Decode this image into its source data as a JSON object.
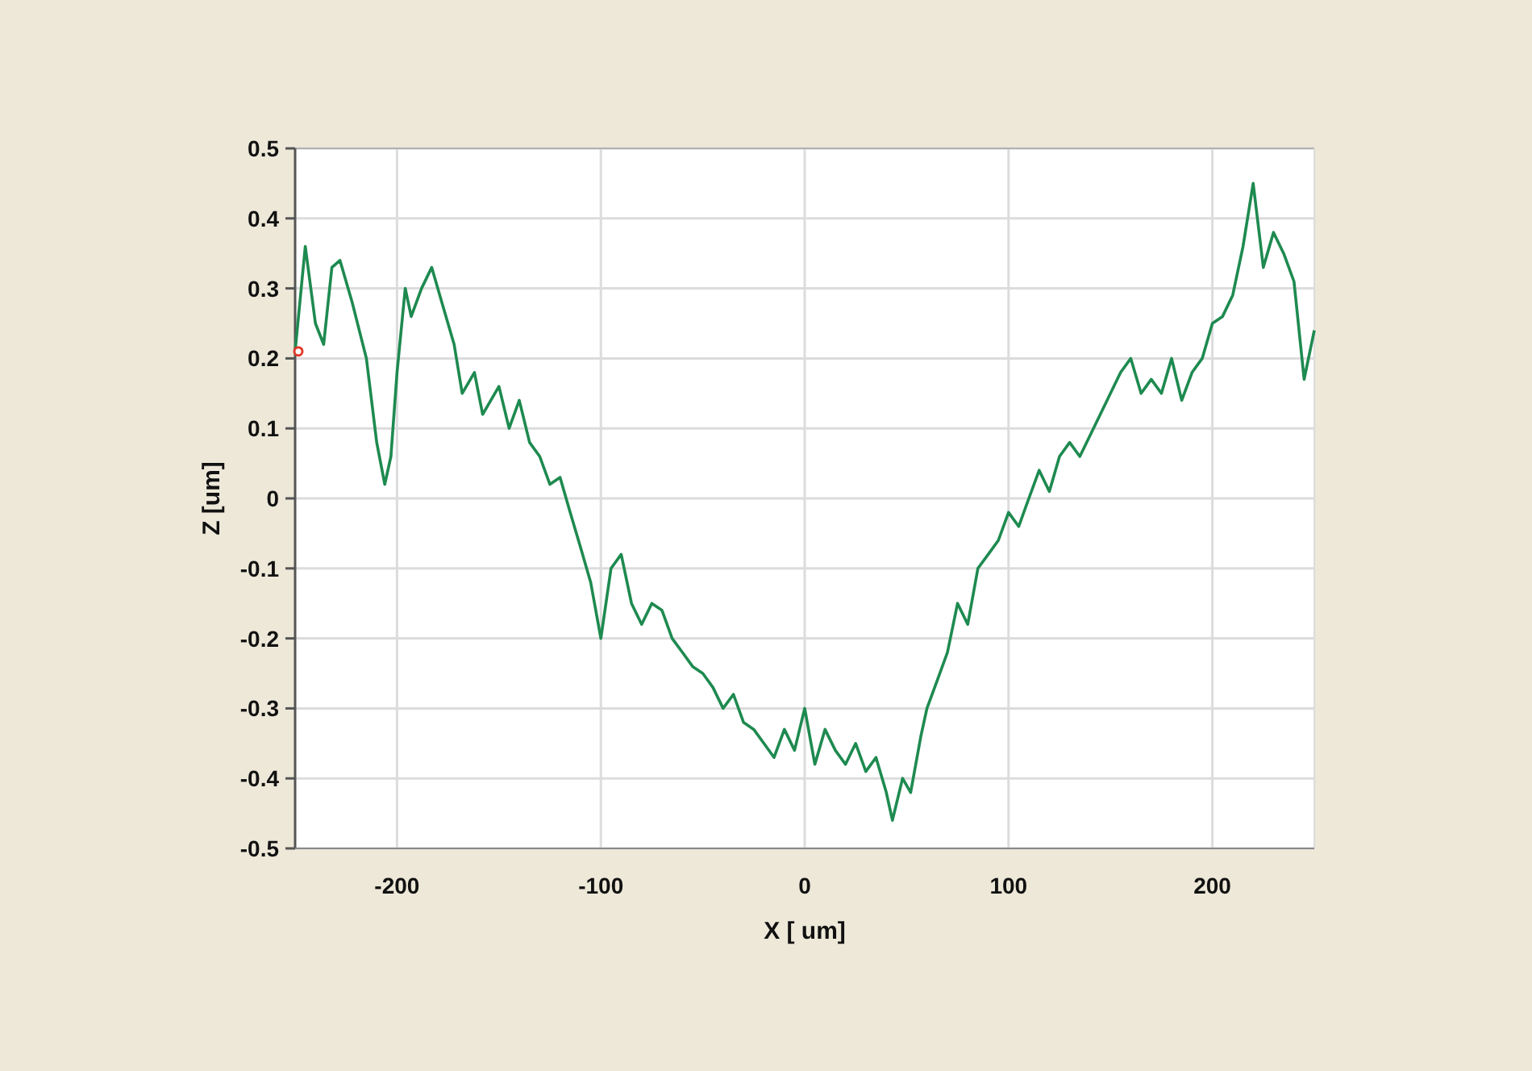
{
  "chart": {
    "chart_data": {
      "type": "line",
      "grid": true,
      "xlabel": "X [ um]",
      "ylabel": "Z [um]",
      "xlim": [
        -250,
        250
      ],
      "ylim": [
        -0.5,
        0.5
      ],
      "xticks": [
        -200,
        -100,
        0,
        100,
        200
      ],
      "yticks": [
        0.5,
        0.4,
        0.3,
        0.2,
        0.1,
        0,
        -0.1,
        -0.2,
        -0.3,
        -0.4,
        -0.5
      ],
      "x": [
        -250,
        -245,
        -240,
        -236,
        -232,
        -228,
        -222,
        -215,
        -210,
        -206,
        -203,
        -200,
        -196,
        -193,
        -188,
        -183,
        -178,
        -172,
        -168,
        -162,
        -158,
        -150,
        -145,
        -140,
        -135,
        -130,
        -125,
        -120,
        -115,
        -110,
        -105,
        -100,
        -95,
        -90,
        -85,
        -80,
        -75,
        -70,
        -65,
        -60,
        -55,
        -50,
        -45,
        -40,
        -35,
        -30,
        -25,
        -20,
        -15,
        -10,
        -5,
        0,
        5,
        10,
        15,
        20,
        25,
        30,
        35,
        40,
        43,
        48,
        52,
        57,
        60,
        65,
        70,
        75,
        80,
        85,
        90,
        95,
        100,
        105,
        110,
        115,
        120,
        125,
        130,
        135,
        140,
        145,
        150,
        155,
        160,
        165,
        170,
        175,
        180,
        185,
        190,
        195,
        200,
        205,
        210,
        215,
        220,
        225,
        230,
        235,
        240,
        245,
        250
      ],
      "series": [
        {
          "color": "#1e8a50",
          "values": [
            0.21,
            0.36,
            0.25,
            0.22,
            0.33,
            0.34,
            0.28,
            0.2,
            0.08,
            0.02,
            0.06,
            0.18,
            0.3,
            0.26,
            0.3,
            0.33,
            0.28,
            0.22,
            0.15,
            0.18,
            0.12,
            0.16,
            0.1,
            0.14,
            0.08,
            0.06,
            0.02,
            0.03,
            -0.02,
            -0.07,
            -0.12,
            -0.2,
            -0.1,
            -0.08,
            -0.15,
            -0.18,
            -0.15,
            -0.16,
            -0.2,
            -0.22,
            -0.24,
            -0.25,
            -0.27,
            -0.3,
            -0.28,
            -0.32,
            -0.33,
            -0.35,
            -0.37,
            -0.33,
            -0.36,
            -0.3,
            -0.38,
            -0.33,
            -0.36,
            -0.38,
            -0.35,
            -0.39,
            -0.37,
            -0.42,
            -0.46,
            -0.4,
            -0.42,
            -0.34,
            -0.3,
            -0.26,
            -0.22,
            -0.15,
            -0.18,
            -0.1,
            -0.08,
            -0.06,
            -0.02,
            -0.04,
            0.0,
            0.04,
            0.01,
            0.06,
            0.08,
            0.06,
            0.09,
            0.12,
            0.15,
            0.18,
            0.2,
            0.15,
            0.17,
            0.15,
            0.2,
            0.14,
            0.18,
            0.2,
            0.25,
            0.26,
            0.29,
            0.36,
            0.45,
            0.33,
            0.38,
            0.35,
            0.31,
            0.17,
            0.24
          ]
        }
      ]
    }
  }
}
